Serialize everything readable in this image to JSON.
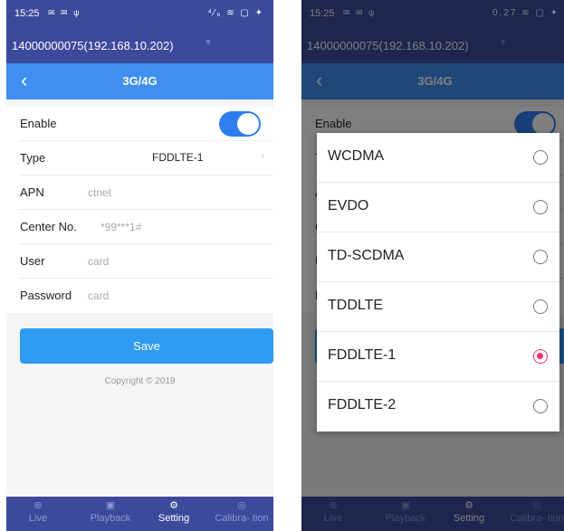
{
  "status": {
    "time": "15:25",
    "left_icons": "✉ ✉ ψ",
    "right_icons_left": "⁴⁄₆ ≋ ▢ ✦",
    "right_icons_right": "0.27 ≋ ▢ ✦"
  },
  "device": {
    "name": "14000000075(192.168.10.202)",
    "dropdown_icon": "chevron-down-icon"
  },
  "header": {
    "title": "3G/4G",
    "back_icon": "back-arrow-icon"
  },
  "form": {
    "enable_label": "Enable",
    "enable_on": true,
    "type_label": "Type",
    "type_value": "FDDLTE-1",
    "apn_label": "APN",
    "apn_placeholder": "ctnet",
    "center_label": "Center No.",
    "center_placeholder": "*99***1#",
    "user_label": "User",
    "user_placeholder": "card",
    "password_label": "Password",
    "password_placeholder": "card",
    "save_label": "Save",
    "copyright": "Copyright © 2019"
  },
  "nav": {
    "tabs": [
      {
        "label": "Live",
        "icon": "live-icon"
      },
      {
        "label": "Playback",
        "icon": "playback-icon"
      },
      {
        "label": "Setting",
        "icon": "gear-icon"
      },
      {
        "label": "Calibra-\ntion",
        "icon": "calibration-icon"
      }
    ],
    "active": "Setting"
  },
  "type_dialog": {
    "options": [
      "WCDMA",
      "EVDO",
      "TD-SCDMA",
      "TDDLTE",
      "FDDLTE-1",
      "FDDLTE-2"
    ],
    "selected": "FDDLTE-1"
  },
  "colors": {
    "primary": "#3c4a9c",
    "accent": "#3f8ef0",
    "save": "#2e9bf0",
    "radio_selected": "#e8336e"
  }
}
